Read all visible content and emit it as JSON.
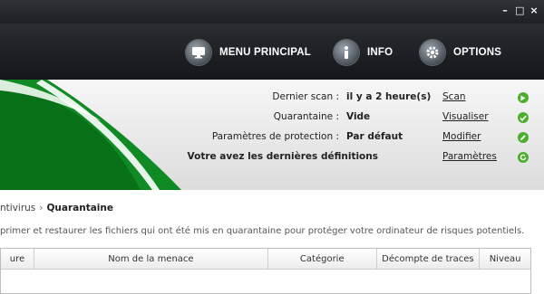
{
  "window": {
    "controls": [
      "–",
      "□",
      "×"
    ]
  },
  "nav": [
    {
      "label": "MENU PRINCIPAL",
      "icon": "monitor-icon"
    },
    {
      "label": "INFO",
      "icon": "info-icon"
    },
    {
      "label": "OPTIONS",
      "icon": "gear-icon"
    }
  ],
  "status": {
    "rows": [
      {
        "label": "Dernier scan :",
        "value": "il y a 2 heure(s)",
        "action": "Scan",
        "icon": "play-icon"
      },
      {
        "label": "Quarantaine :",
        "value": "Vide",
        "action": "Visualiser",
        "icon": "check-icon"
      },
      {
        "label": "Paramètres de protection :",
        "value": "Par défaut",
        "action": "Modifier",
        "icon": "pencil-icon"
      }
    ],
    "definitions": {
      "text": "Votre avez les dernières définitions",
      "action": "Paramètres",
      "icon": "refresh-icon"
    }
  },
  "colors": {
    "accent_green": "#4caf2b",
    "brand_green": "#0a7d1e"
  },
  "breadcrumb": {
    "parent": "ntivirus",
    "separator": "›",
    "current": "Quarantaine"
  },
  "description": "primer et restaurer les fichiers qui ont été mis en quarantaine pour protéger votre ordinateur de risques potentiels.",
  "table": {
    "columns": [
      "ure",
      "Nom de la menace",
      "Catégorie",
      "Décompte de traces",
      "Niveau"
    ]
  }
}
